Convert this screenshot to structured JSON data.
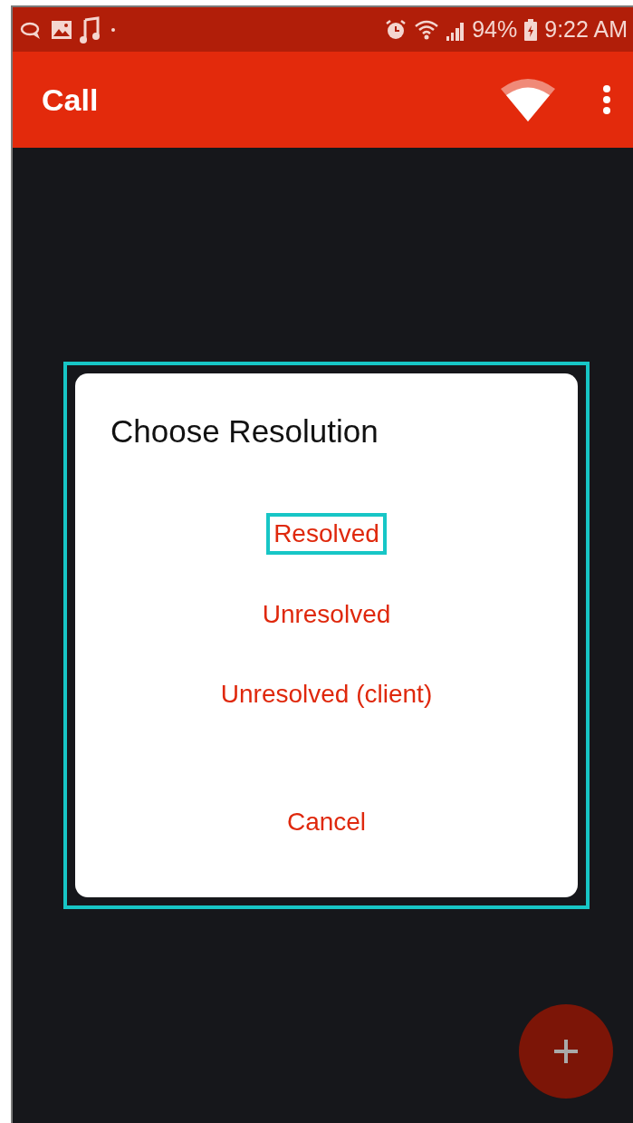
{
  "status_bar": {
    "battery": "94%",
    "time": "9:22 AM"
  },
  "app_bar": {
    "title": "Call"
  },
  "dialog": {
    "highlighted": true,
    "title": "Choose Resolution",
    "options": [
      {
        "label": "Resolved",
        "selected": true
      },
      {
        "label": "Unresolved",
        "selected": false
      },
      {
        "label": "Unresolved (client)",
        "selected": false
      }
    ],
    "cancel": "Cancel"
  }
}
